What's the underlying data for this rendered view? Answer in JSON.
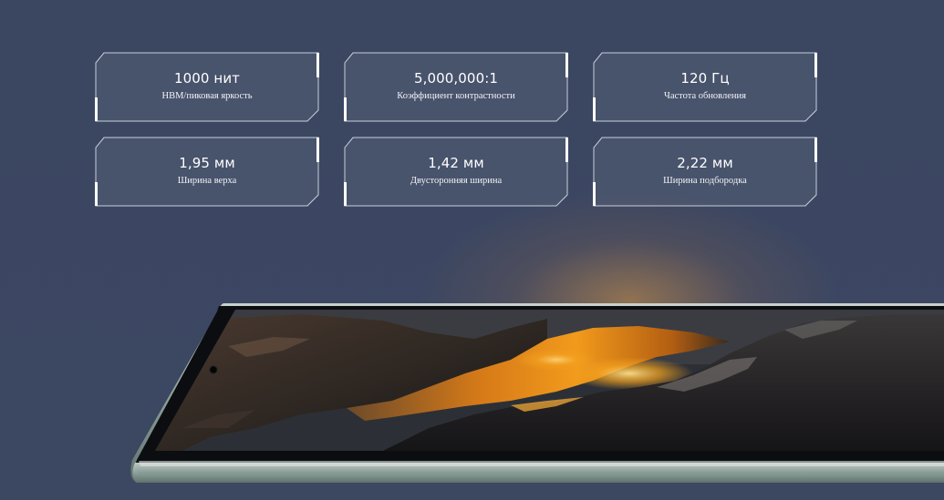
{
  "specs": [
    {
      "value": "1000 нит",
      "label": "HBM/пиковая яркость"
    },
    {
      "value": "5,000,000:1",
      "label": "Коэффициент контрастности"
    },
    {
      "value": "120 Гц",
      "label": "Частота обновления"
    },
    {
      "value": "1,95 мм",
      "label": "Ширина верха"
    },
    {
      "value": "1,42 мм",
      "label": "Двусторонняя ширина"
    },
    {
      "value": "2,22 мм",
      "label": "Ширина подбородка"
    }
  ],
  "colors": {
    "background": "#3a4661",
    "card_border": "#c9cfdb",
    "accent_glow": "#e8912a",
    "text": "#ffffff"
  },
  "phone": {
    "screen_image": "wallpaper-rocks-orange-river"
  }
}
